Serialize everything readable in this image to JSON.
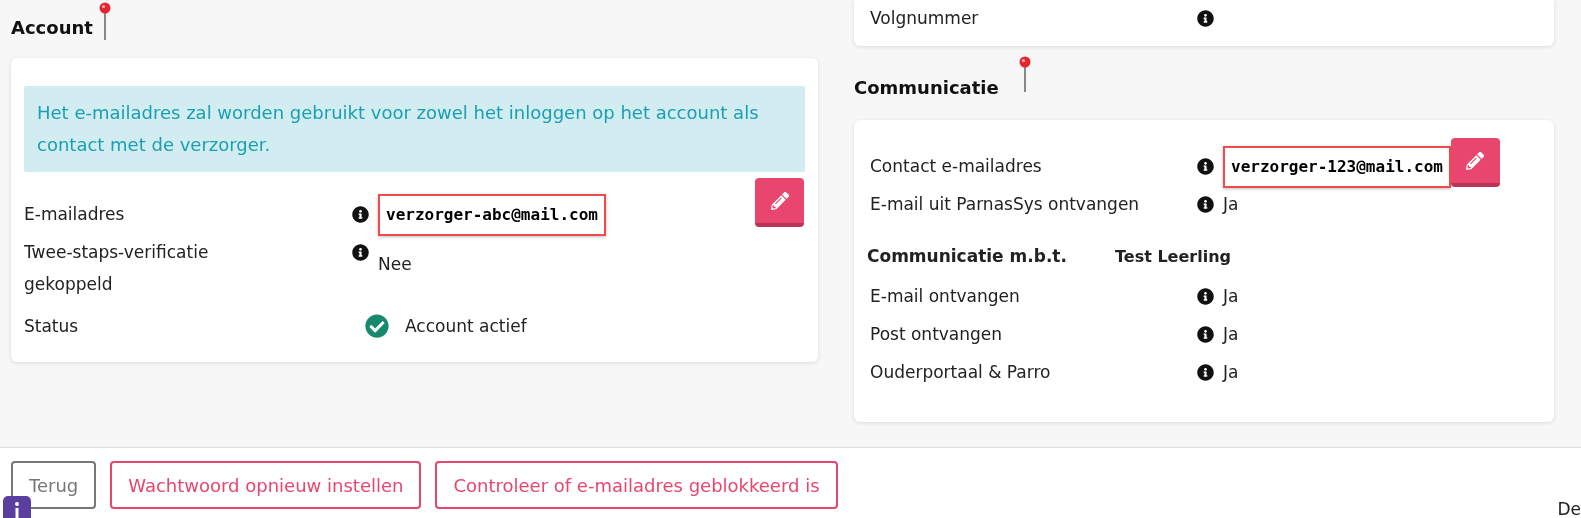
{
  "account": {
    "title": "Account",
    "pinned": true,
    "alert": "Het e-mailadres zal worden gebruikt voor zowel het inloggen op het account als contact met de verzorger.",
    "fields": [
      {
        "label": "E-mailadres",
        "kind": "email",
        "value": "verzorger-abc@mail.com",
        "highlighted": true,
        "editable": true
      },
      {
        "label": "Twee-staps-verificatie gekoppeld",
        "kind": "text",
        "value": "Nee"
      },
      {
        "label": "Status",
        "kind": "status",
        "value": "Account actief"
      }
    ]
  },
  "details": {
    "fields": [
      {
        "label": "Volgnummer"
      }
    ]
  },
  "communication": {
    "title": "Communicatie",
    "pinned": true,
    "fields": [
      {
        "label": "Contact e-mailadres",
        "kind": "email",
        "value": "verzorger-123@mail.com",
        "highlighted": true,
        "editable": true
      },
      {
        "label": "E-mail uit ParnasSys ontvangen",
        "kind": "text",
        "value": "Ja"
      }
    ],
    "regarding": {
      "label": "Communicatie m.b.t.",
      "student": "Test Leerling"
    },
    "preferences": [
      {
        "label": "E-mail ontvangen",
        "value": "Ja"
      },
      {
        "label": "Post ontvangen",
        "value": "Ja"
      },
      {
        "label": "Ouderportaal & Parro",
        "value": "Ja"
      }
    ]
  },
  "footer": {
    "buttons": [
      {
        "label": "Terug",
        "kind": "secondary"
      },
      {
        "label": "Wachtwoord opnieuw instellen",
        "kind": "danger"
      },
      {
        "label": "Controleer of e-mailadres geblokkeerd is",
        "kind": "danger"
      }
    ],
    "note": "De"
  }
}
